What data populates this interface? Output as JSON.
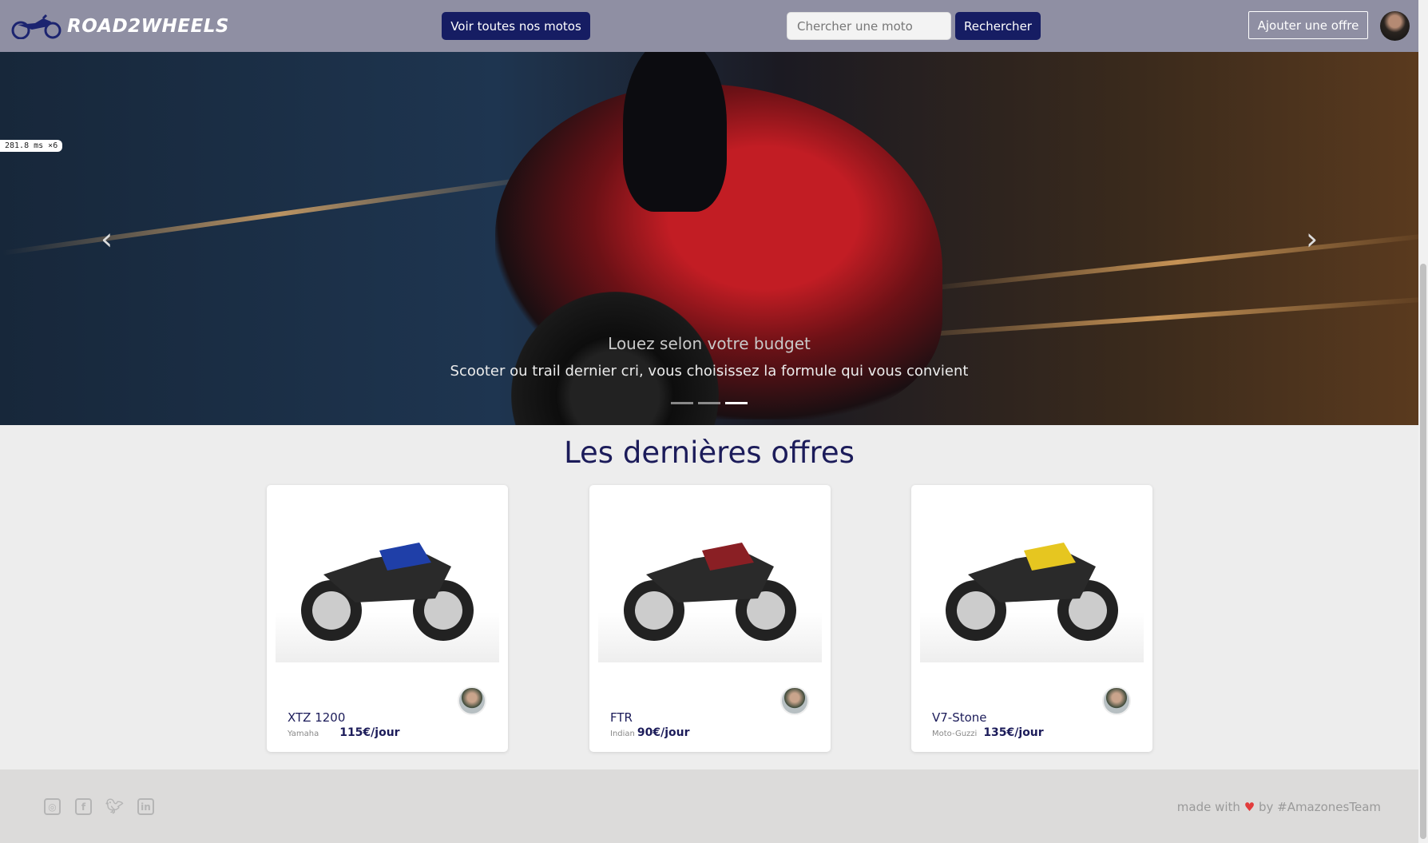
{
  "nav": {
    "brand": "ROAD2WHEELS",
    "all_motos_label": "Voir toutes nos motos",
    "search_placeholder": "Chercher une moto",
    "search_button": "Rechercher",
    "add_offer_label": "Ajouter une offre"
  },
  "perf_overlay": "281.8 ms ×6",
  "hero": {
    "title": "Louez selon votre budget",
    "subtitle": "Scooter ou trail dernier cri, vous choisissez la formule qui vous convient",
    "slide_count": 3,
    "active_slide": 3,
    "prev_icon": "‹",
    "next_icon": "›"
  },
  "offers": {
    "title": "Les dernières offres",
    "items": [
      {
        "name": "XTZ 1200",
        "brand": "Yamaha",
        "price": "115€/jour",
        "color": "#1f3fa8"
      },
      {
        "name": "FTR",
        "brand": "Indian",
        "price": "90€/jour",
        "color": "#8a1f24"
      },
      {
        "name": "V7-Stone",
        "brand": "Moto-Guzzi",
        "price": "135€/jour",
        "color": "#e6c620"
      }
    ]
  },
  "footer": {
    "social": [
      "instagram-icon",
      "facebook-icon",
      "twitter-icon",
      "linkedin-icon"
    ],
    "made_with": "made with",
    "heart": "♥",
    "by": "by #AmazonesTeam"
  },
  "colors": {
    "primary": "#161d63",
    "navbar": "#8f8fa3",
    "heart": "#e23c3c"
  }
}
